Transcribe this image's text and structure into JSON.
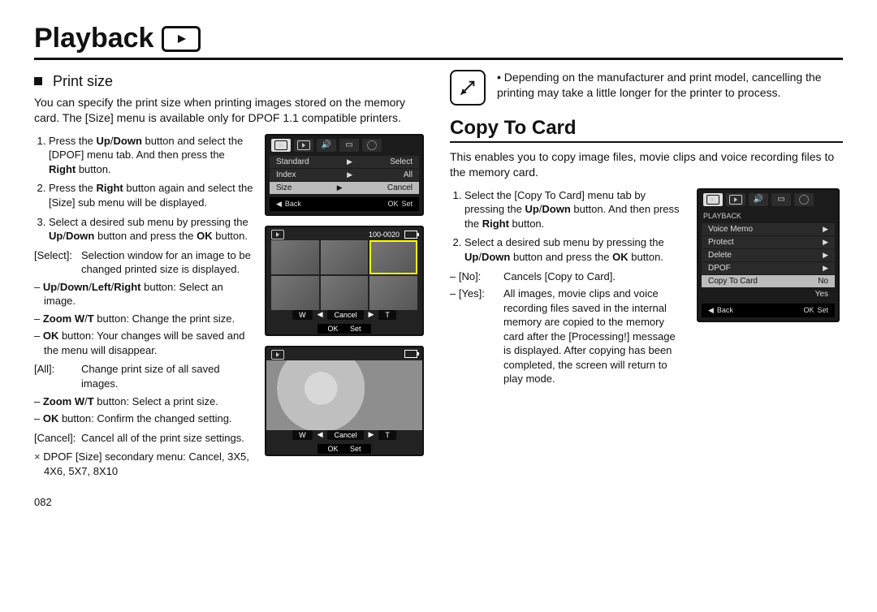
{
  "page": {
    "title": "Playback",
    "number": "082"
  },
  "left": {
    "sub_heading": "Print size",
    "intro": "You can specify the print size when printing images stored on the memory card. The [Size] menu is available only for DPOF 1.1 compatible printers.",
    "steps": {
      "s1_a": "Press the ",
      "s1_b": "Up",
      "s1_c": "/",
      "s1_d": "Down",
      "s1_e": " button and select the [DPOF] menu tab. And then press the ",
      "s1_f": "Right",
      "s1_g": " button.",
      "s2_a": "Press the ",
      "s2_b": "Right",
      "s2_c": " button again and select the [Size] sub menu will be displayed.",
      "s3_a": "Select a desired sub menu by pressing the ",
      "s3_b": "Up",
      "s3_c": "/",
      "s3_d": "Down",
      "s3_e": " button and press the ",
      "s3_f": "OK",
      "s3_g": " button."
    },
    "defs": {
      "select_k": "[Select]:",
      "select_v": "Selection window for an image to be changed printed size is displayed.",
      "dash1_a": "Up",
      "dash1_b": "/",
      "dash1_c": "Down",
      "dash1_d": "/",
      "dash1_e": "Left",
      "dash1_f": "/",
      "dash1_g": "Right",
      "dash1_h": " button: Select an image.",
      "dash2_a": "Zoom W",
      "dash2_b": "/",
      "dash2_c": "T",
      "dash2_d": " button: Change the print size.",
      "dash3_a": "OK",
      "dash3_b": " button: Your changes will be saved and the menu will disappear.",
      "all_k": "[All]:",
      "all_v": "Change print size of all saved images.",
      "dash4_a": "Zoom W",
      "dash4_b": "/",
      "dash4_c": "T",
      "dash4_d": " button: Select a print size.",
      "dash5_a": "OK",
      "dash5_b": " button: Confirm the changed setting.",
      "cancel_k": "[Cancel]:",
      "cancel_v": "Cancel all of the print size settings."
    },
    "note": "DPOF [Size] secondary menu: Cancel, 3X5, 4X6, 5X7, 8X10",
    "lcd1": {
      "row1_l": "Standard",
      "row1_r": "Select",
      "row2_l": "Index",
      "row2_r": "All",
      "row3_l": "Size",
      "row3_r": "Cancel",
      "back": "Back",
      "set": "Set",
      "ok": "OK"
    },
    "lcd2": {
      "counter": "100-0020",
      "W": "W",
      "T": "T",
      "cancel": "Cancel",
      "ok": "OK",
      "set": "Set"
    },
    "lcd3": {
      "W": "W",
      "T": "T",
      "cancel": "Cancel",
      "ok": "OK",
      "set": "Set"
    }
  },
  "right": {
    "tip": "Depending on the manufacturer and print model, cancelling the printing may take a little longer for the printer to process.",
    "section_heading": "Copy To Card",
    "intro": "This enables you to copy image files, movie clips and voice recording files to the memory card.",
    "steps": {
      "s1_a": "Select the [Copy To Card] menu tab by pressing the ",
      "s1_b": "Up",
      "s1_c": "/",
      "s1_d": "Down",
      "s1_e": " button. And then press the ",
      "s1_f": "Right",
      "s1_g": " button.",
      "s2_a": "Select a desired sub menu by pressing the ",
      "s2_b": "Up",
      "s2_c": "/",
      "s2_d": "Down",
      "s2_e": " button and press the ",
      "s2_f": "OK",
      "s2_g": " button."
    },
    "defs": {
      "no_k": "– [No]:",
      "no_v": "Cancels [Copy to Card].",
      "yes_k": "– [Yes]:",
      "yes_v": "All images, movie clips and voice recording files saved in the internal memory are copied to the memory card after the [Processing!] message is displayed. After copying has been completed, the screen will return to play mode."
    },
    "lcd": {
      "header": "PLAYBACK",
      "r1": "Voice Memo",
      "r2": "Protect",
      "r3": "Delete",
      "r4": "DPOF",
      "r5": "Copy To Card",
      "opt_no": "No",
      "opt_yes": "Yes",
      "back": "Back",
      "ok": "OK",
      "set": "Set"
    }
  }
}
